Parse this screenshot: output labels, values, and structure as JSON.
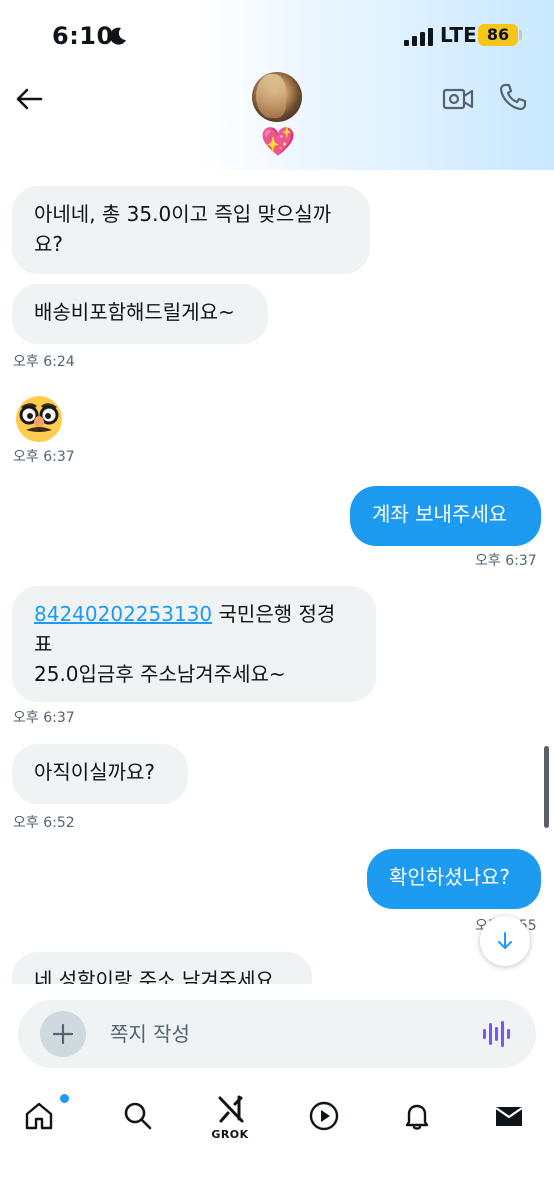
{
  "status_bar": {
    "time": "6:10",
    "network": "LTE",
    "battery": "86"
  },
  "header": {
    "contact_name_emoji": "💖",
    "icons": {
      "back": "arrow-left-icon",
      "video": "video-call-icon",
      "phone": "phone-icon"
    }
  },
  "messages": [
    {
      "direction": "in",
      "lines": [
        "아네네, 총 35.0이고 즉입 맞으실까",
        "요?"
      ]
    },
    {
      "direction": "in",
      "text": "배송비포함해드릴게요~",
      "time": "오후 6:24"
    },
    {
      "direction": "in",
      "emoji": "nerd-disguise-face-emoji",
      "time": "오후 6:37"
    },
    {
      "direction": "out",
      "text": "계좌 보내주세요",
      "time": "오후 6:37"
    },
    {
      "direction": "in",
      "link": "84240202253130",
      "line1_rest": " 국민은행 정경",
      "line2": "표",
      "line3": "25.0입금후 주소남겨주세요~",
      "time": "오후 6:37"
    },
    {
      "direction": "in",
      "text": "아직이실까요?",
      "time": "오후 6:52"
    },
    {
      "direction": "out",
      "text": "확인하셨나요?",
      "time": "오후 6:55"
    },
    {
      "direction": "in",
      "text": "네 성함이랑 주소 남겨주세요"
    }
  ],
  "composer": {
    "placeholder": "쪽지 작성"
  },
  "tab_bar": {
    "grok_label": "GROK"
  },
  "colors": {
    "accent": "#1d9bf0",
    "incoming_bubble": "#eff3f4",
    "text_primary": "#0f1419",
    "text_secondary": "#536471",
    "battery": "#f5c518"
  }
}
